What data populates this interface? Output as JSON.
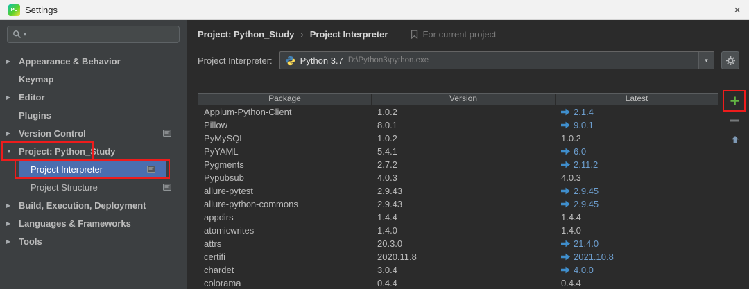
{
  "window": {
    "title": "Settings",
    "close_glyph": "×",
    "app_icon_text": "PC"
  },
  "icons": {
    "chevron_down": "▾",
    "tree_collapsed": "▶",
    "tree_expanded": "▼"
  },
  "sidebar": {
    "items": [
      {
        "label": "Appearance & Behavior",
        "arrow": "right",
        "bold": true
      },
      {
        "label": "Keymap",
        "bold": true
      },
      {
        "label": "Editor",
        "arrow": "right",
        "bold": true
      },
      {
        "label": "Plugins",
        "bold": true
      },
      {
        "label": "Version Control",
        "arrow": "right",
        "bold": true,
        "badge": true
      },
      {
        "label": "Project: Python_Study",
        "arrow": "down",
        "bold": true
      },
      {
        "label": "Project Interpreter",
        "indent": true,
        "selected": true,
        "badge": true
      },
      {
        "label": "Project Structure",
        "indent": true,
        "badge": true
      },
      {
        "label": "Build, Execution, Deployment",
        "arrow": "right",
        "bold": true
      },
      {
        "label": "Languages & Frameworks",
        "arrow": "right",
        "bold": true
      },
      {
        "label": "Tools",
        "arrow": "right",
        "bold": true
      }
    ]
  },
  "breadcrumb": {
    "part1": "Project: Python_Study",
    "separator": "›",
    "part2": "Project Interpreter",
    "note": "For current project"
  },
  "interpreter": {
    "label": "Project Interpreter:",
    "name": "Python 3.7",
    "path": "D:\\Python3\\python.exe"
  },
  "packages": {
    "columns": [
      "Package",
      "Version",
      "Latest"
    ],
    "rows": [
      {
        "package": "Appium-Python-Client",
        "version": "1.0.2",
        "latest": "2.1.4",
        "upgrade": true
      },
      {
        "package": "Pillow",
        "version": "8.0.1",
        "latest": "9.0.1",
        "upgrade": true
      },
      {
        "package": "PyMySQL",
        "version": "1.0.2",
        "latest": "1.0.2",
        "upgrade": false
      },
      {
        "package": "PyYAML",
        "version": "5.4.1",
        "latest": "6.0",
        "upgrade": true
      },
      {
        "package": "Pygments",
        "version": "2.7.2",
        "latest": "2.11.2",
        "upgrade": true
      },
      {
        "package": "Pypubsub",
        "version": "4.0.3",
        "latest": "4.0.3",
        "upgrade": false
      },
      {
        "package": "allure-pytest",
        "version": "2.9.43",
        "latest": "2.9.45",
        "upgrade": true
      },
      {
        "package": "allure-python-commons",
        "version": "2.9.43",
        "latest": "2.9.45",
        "upgrade": true
      },
      {
        "package": "appdirs",
        "version": "1.4.4",
        "latest": "1.4.4",
        "upgrade": false
      },
      {
        "package": "atomicwrites",
        "version": "1.4.0",
        "latest": "1.4.0",
        "upgrade": false
      },
      {
        "package": "attrs",
        "version": "20.3.0",
        "latest": "21.4.0",
        "upgrade": true
      },
      {
        "package": "certifi",
        "version": "2020.11.8",
        "latest": "2021.10.8",
        "upgrade": true
      },
      {
        "package": "chardet",
        "version": "3.0.4",
        "latest": "4.0.0",
        "upgrade": true
      },
      {
        "package": "colorama",
        "version": "0.4.4",
        "latest": "0.4.4",
        "upgrade": false
      }
    ]
  },
  "colors": {
    "selection_blue": "#4b6eaf",
    "upgrade_blue": "#6d9ece",
    "plus_green": "#62b543",
    "annotation_red": "#ee1c1c"
  }
}
